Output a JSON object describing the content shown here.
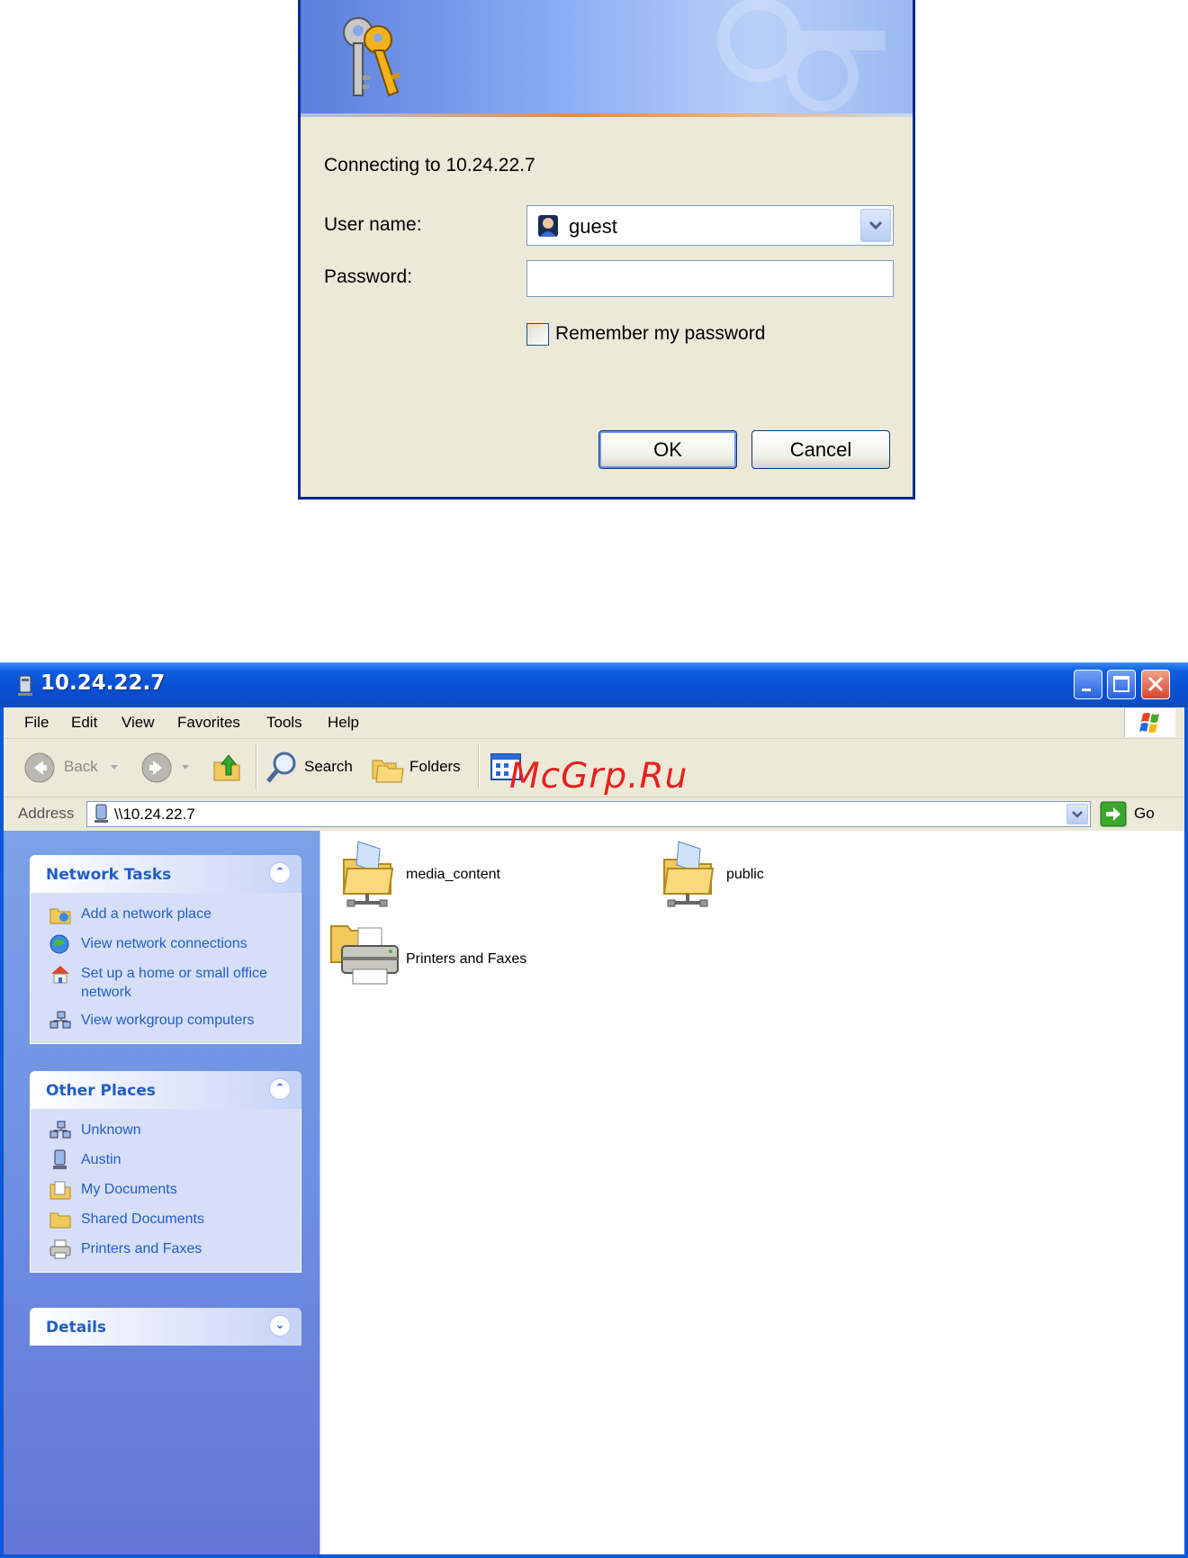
{
  "dialog": {
    "connecting_text": "Connecting to 10.24.22.7",
    "username_label": "User name:",
    "username_value": "guest",
    "password_label": "Password:",
    "password_value": "",
    "remember_label": "Remember my password",
    "remember_checked": false,
    "ok_label": "OK",
    "cancel_label": "Cancel"
  },
  "window": {
    "title": "10.24.22.7",
    "menu": [
      "File",
      "Edit",
      "View",
      "Favorites",
      "Tools",
      "Help"
    ],
    "toolbar": {
      "back_label": "Back",
      "search_label": "Search",
      "folders_label": "Folders"
    },
    "address": {
      "label": "Address",
      "value": "\\\\10.24.22.7",
      "go_label": "Go"
    }
  },
  "left_pane": {
    "network_tasks": {
      "title": "Network Tasks",
      "items": [
        "Add a network place",
        "View network connections",
        "Set up a home or small office network",
        "View workgroup computers"
      ]
    },
    "other_places": {
      "title": "Other Places",
      "items": [
        "Unknown",
        "Austin",
        "My Documents",
        "Shared Documents",
        "Printers and Faxes"
      ]
    },
    "details": {
      "title": "Details"
    }
  },
  "content": {
    "items": [
      {
        "label": "media_content",
        "icon": "shared-folder-icon"
      },
      {
        "label": "public",
        "icon": "shared-folder-icon"
      },
      {
        "label": "Printers and Faxes",
        "icon": "printers-folder-icon"
      }
    ]
  },
  "watermark": "McGrp.Ru",
  "colors": {
    "xp_blue": "#0b58d8",
    "link_blue": "#215dc6",
    "dialog_bg": "#ece9d8",
    "watermark_red": "#e6211d"
  }
}
